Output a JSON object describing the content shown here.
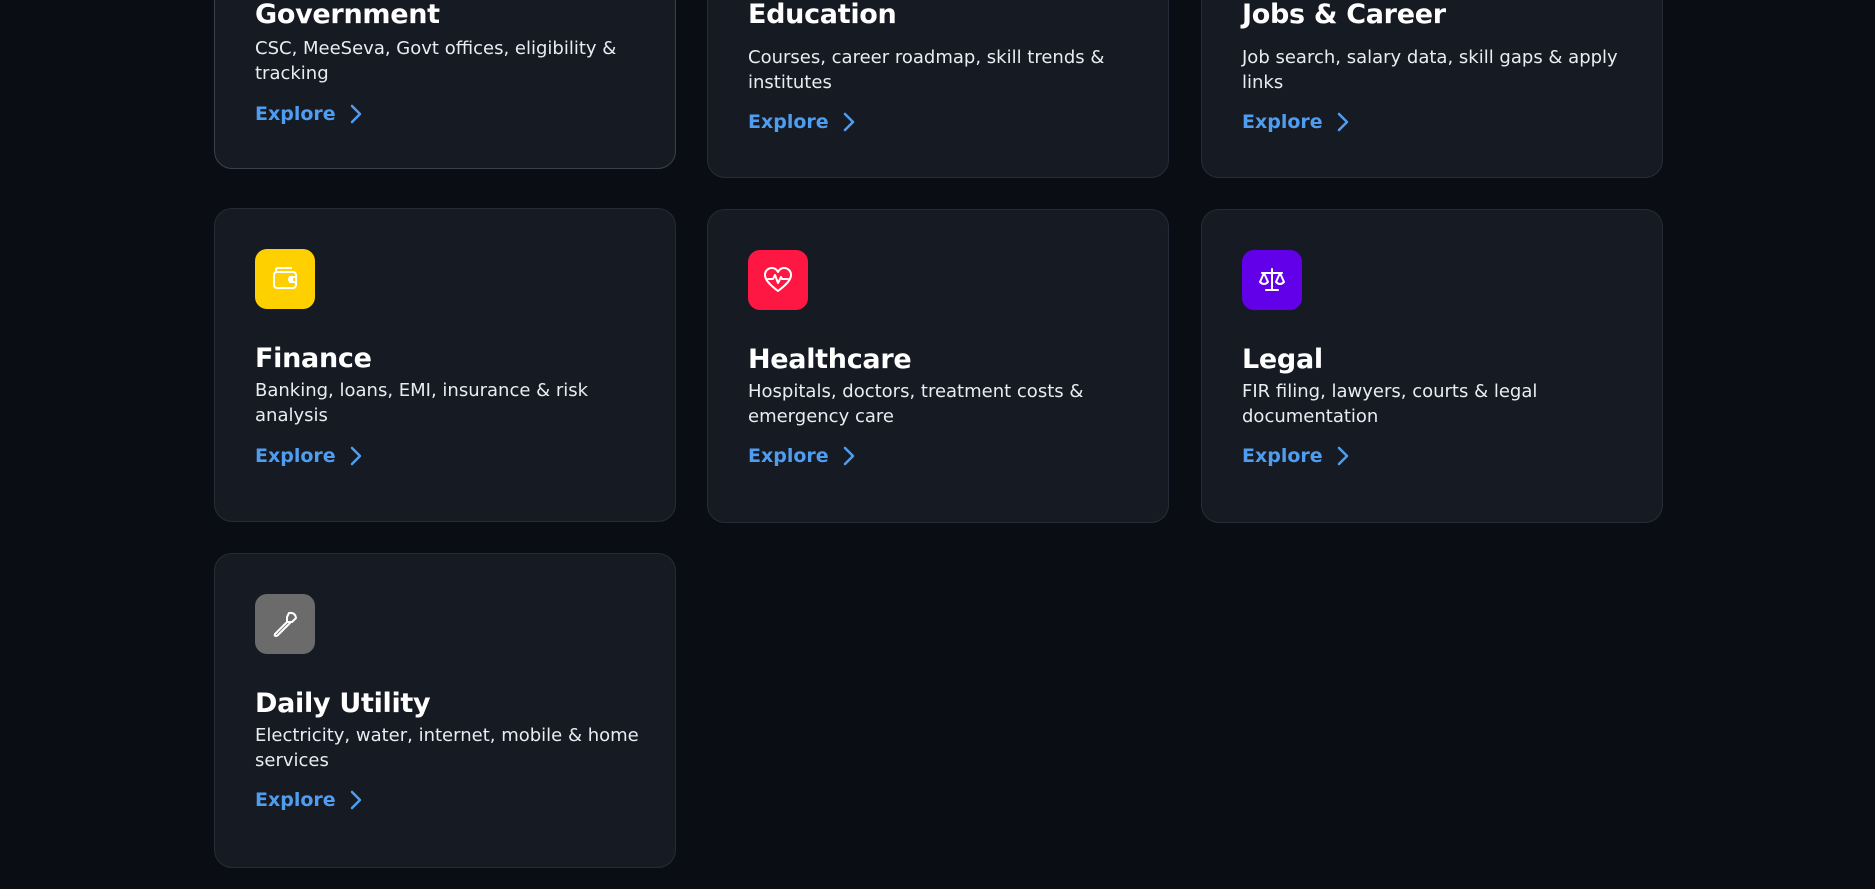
{
  "cards": [
    {
      "title": "Government",
      "description": "CSC, MeeSeva, Govt offices, eligibility & tracking",
      "cta": "Explore",
      "icon": "government-icon"
    },
    {
      "title": "Education",
      "description": "Courses, career roadmap, skill trends & institutes",
      "cta": "Explore",
      "icon": "education-icon"
    },
    {
      "title": "Jobs & Career",
      "description": "Job search, salary data, skill gaps & apply links",
      "cta": "Explore",
      "icon": "briefcase-icon"
    },
    {
      "title": "Finance",
      "description": "Banking, loans, EMI, insurance & risk analysis",
      "cta": "Explore",
      "icon": "wallet-icon",
      "color": "#ffd000"
    },
    {
      "title": "Healthcare",
      "description": "Hospitals, doctors, treatment costs & emergency care",
      "cta": "Explore",
      "icon": "heart-pulse-icon",
      "color": "#ff1744"
    },
    {
      "title": "Legal",
      "description": "FIR filing, lawyers, courts & legal documentation",
      "cta": "Explore",
      "icon": "scales-icon",
      "color": "#6200ea"
    },
    {
      "title": "Daily Utility",
      "description": "Electricity, water, internet, mobile & home services",
      "cta": "Explore",
      "icon": "wrench-icon",
      "color": "#6b6b6b"
    }
  ],
  "colors": {
    "background": "#0b0d14",
    "card": "#161a22",
    "accent": "#4f9df0"
  }
}
